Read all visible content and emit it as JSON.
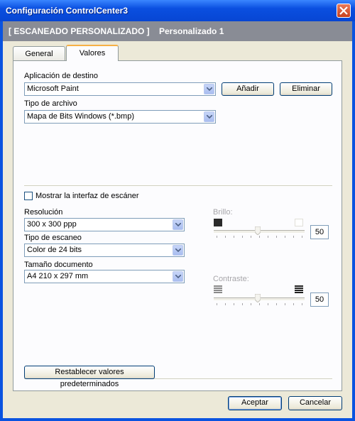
{
  "window": {
    "title": "Configuración ControlCenter3"
  },
  "header": {
    "left": "[  ESCANEADO PERSONALIZADO  ]",
    "right": "Personalizado 1"
  },
  "tabs": [
    {
      "label": "General"
    },
    {
      "label": "Valores"
    }
  ],
  "destino": {
    "label": "Aplicación de destino",
    "value": "Microsoft Paint",
    "add_label": "Añadir",
    "remove_label": "Eliminar"
  },
  "tipo_archivo": {
    "label": "Tipo de archivo",
    "value": "Mapa de Bits Windows (*.bmp)"
  },
  "mostrar": {
    "label": "Mostrar la interfaz de escáner",
    "checked": false
  },
  "resolucion": {
    "label": "Resolución",
    "value": "300 x 300 ppp"
  },
  "tipo_escaneo": {
    "label": "Tipo de escaneo",
    "value": "Color de 24 bits"
  },
  "tamano": {
    "label": "Tamaño documento",
    "value": "A4 210 x 297 mm"
  },
  "brillo": {
    "label": "Brillo:",
    "value": "50",
    "enabled": false,
    "icon_left": "dark-square-icon",
    "icon_right": "light-square-icon"
  },
  "contraste": {
    "label": "Contraste:",
    "value": "50",
    "enabled": false,
    "icon_left": "low-contrast-icon",
    "icon_right": "high-contrast-icon"
  },
  "reset": {
    "label": "Restablecer valores predeterminados"
  },
  "footer": {
    "accept_label": "Aceptar",
    "cancel_label": "Cancelar"
  }
}
